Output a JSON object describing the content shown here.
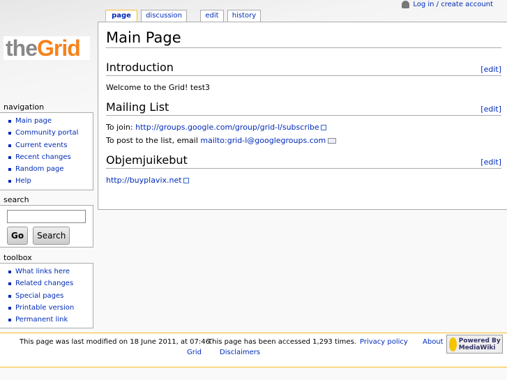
{
  "personal": {
    "login": "Log in / create account"
  },
  "logo": {
    "part1": "the",
    "part2": "Grid"
  },
  "tabs": [
    {
      "label": "page"
    },
    {
      "label": "discussion"
    },
    {
      "label": "edit"
    },
    {
      "label": "history"
    }
  ],
  "content": {
    "title": "Main Page",
    "edit_label": "[edit]",
    "sections": [
      {
        "heading": "Introduction",
        "text": "Welcome to the Grid! test3"
      },
      {
        "heading": "Mailing List",
        "join_label": "To join:",
        "join_link": "http://groups.google.com/group/grid-l/subscribe",
        "post_label": "To post to the list, email",
        "post_link": "mailto:grid-l@googlegroups.com"
      },
      {
        "heading": "Objemjuikebut",
        "link": "http://buyplavix.net"
      }
    ]
  },
  "navigation": {
    "title": "navigation",
    "items": [
      "Main page",
      "Community portal",
      "Current events",
      "Recent changes",
      "Random page",
      "Help"
    ]
  },
  "search": {
    "title": "search",
    "go": "Go",
    "search": "Search",
    "value": ""
  },
  "toolbox": {
    "title": "toolbox",
    "items": [
      "What links here",
      "Related changes",
      "Special pages",
      "Printable version",
      "Permanent link"
    ]
  },
  "footer": {
    "modified": "This page was last modified on 18 June 2011, at 07:46.",
    "accessed": "This page has been accessed 1,293 times.",
    "privacy": "Privacy policy",
    "about": "About",
    "grid": "Grid",
    "disclaimers": "Disclaimers",
    "badge": "Powered By MediaWiki"
  }
}
